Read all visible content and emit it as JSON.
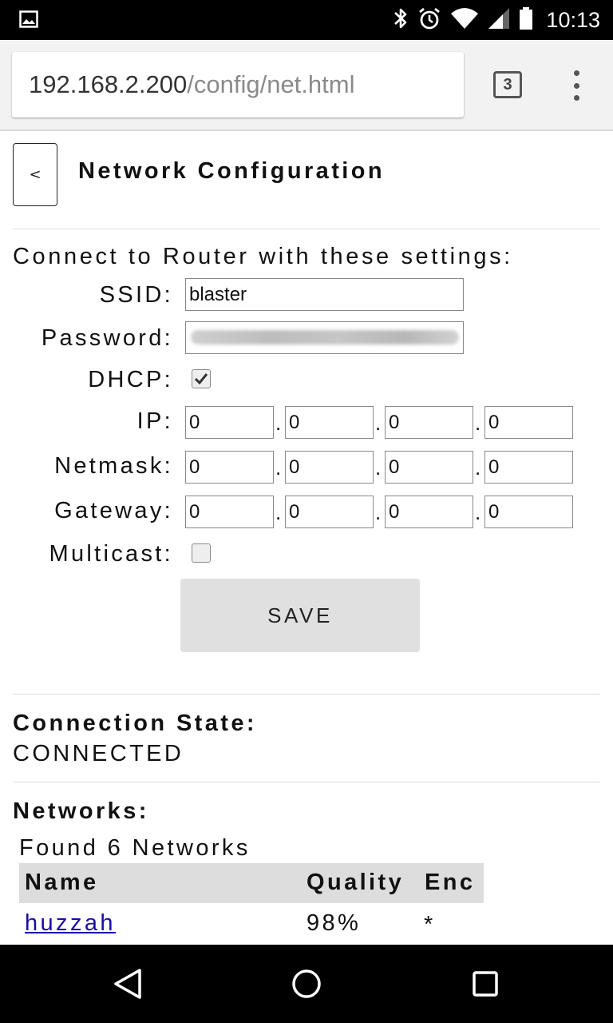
{
  "status_bar": {
    "time": "10:13",
    "icons": [
      "image-icon",
      "bluetooth-icon",
      "alarm-icon",
      "wifi-icon",
      "cell-signal-icon",
      "battery-icon"
    ]
  },
  "browser": {
    "url_host": "192.168.2.200",
    "url_path": "/config/net.html",
    "tab_count": "3"
  },
  "page": {
    "back_label": "<",
    "title": "Network Configuration",
    "intro": "Connect to Router with these settings:",
    "form": {
      "ssid_label": "SSID:",
      "ssid_value": "blaster",
      "password_label": "Password:",
      "dhcp_label": "DHCP:",
      "dhcp_checked": true,
      "ip_label": "IP:",
      "ip": [
        "0",
        "0",
        "0",
        "0"
      ],
      "netmask_label": "Netmask:",
      "netmask": [
        "0",
        "0",
        "0",
        "0"
      ],
      "gateway_label": "Gateway:",
      "gateway": [
        "0",
        "0",
        "0",
        "0"
      ],
      "multicast_label": "Multicast:",
      "multicast_checked": false,
      "octet_separator": ".",
      "save_label": "SAVE"
    },
    "connection": {
      "heading": "Connection State:",
      "state": "CONNECTED"
    },
    "networks": {
      "heading": "Networks:",
      "found": "Found 6 Networks",
      "columns": [
        "Name",
        "Quality",
        "Enc"
      ],
      "rows": [
        {
          "name": "huzzah",
          "quality": "98%",
          "enc": "*"
        }
      ]
    }
  },
  "nav_bar": {
    "buttons": [
      "back-icon",
      "home-icon",
      "recents-icon"
    ]
  }
}
